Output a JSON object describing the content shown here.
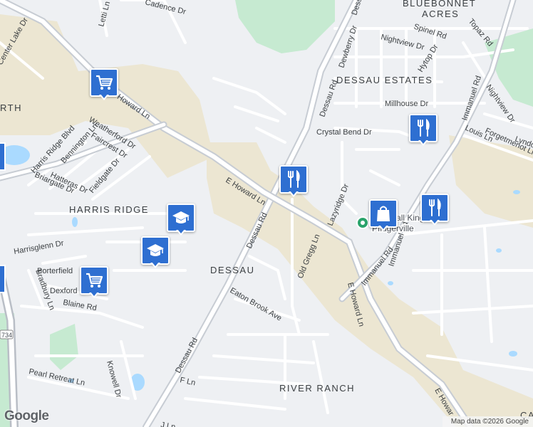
{
  "map": {
    "area_labels": {
      "bluebonnet_acres_1": "BLUEBONNET",
      "bluebonnet_acres_2": "ACRES",
      "dessau_estates": "DESSAU ESTATES",
      "harris_ridge": "HARRIS RIDGE",
      "dessau": "DESSAU",
      "river_ranch": "RIVER RANCH",
      "north_partial": "RTH",
      "ca_partial": "CA"
    },
    "road_labels": {
      "dessau_rd_top": "Dessau",
      "dessau_rd_1": "Dessau Rd",
      "dessau_rd_2": "Dessau Rd",
      "dessau_rd_3": "Dessau Rd",
      "e_howard_1": "E Howard Ln",
      "e_howard_2": "E Howard Ln",
      "e_howard_3": "E Howard Ln",
      "e_howard_4": "E Howar",
      "harris_ridge_blvd": "Harris Ridge Blvd",
      "immanuel_1": "Immanuel Rd",
      "immanuel_2": "Immanuel Rd",
      "immanuel_3": "Immanuel Rd",
      "spinel": "Spinel Rd",
      "topaz": "Topaz Rd",
      "nightview_1": "Nightview Dr",
      "nightview_2": "Nightview Dr",
      "hytop": "Hytop Dr",
      "dewberry": "Dewberry Dr",
      "millhouse": "Millhouse Dr",
      "crystal_bend": "Crystal Bend Dr",
      "louis": "Louis Ln",
      "forgetmenot": "Forgetmenot Ln",
      "lyndon": "Lyndo",
      "lazyridge": "Lazyridge Dr",
      "old_gregg": "Old Gregg Ln",
      "eaton_brook": "Eaton Brook Ave",
      "weatherford": "Weatherford Dr",
      "faircrest": "Faircrest Dr",
      "bennington": "Bennington Ln",
      "hatteras": "Hatteras Dr",
      "fieldgate": "Fieldgate Dr",
      "briargate": "Briargate Dr",
      "harrisglenn": "Harrisglenn Dr",
      "porterfield": "Porterfield",
      "dexford": "Dexford",
      "bradbury": "Bradbury Ln",
      "blaine": "Blaine Rd",
      "pearl_retreat": "Pearl Retreat Ln",
      "knowell": "Knowell Dr",
      "f_ln": "F Ln",
      "j_ln": "J Ln",
      "cadence": "Cadence Dr",
      "letti": "Letti Ln",
      "center_lake": "Center Lake Dr",
      "shield_734": "734"
    },
    "poi_labels": {
      "baseball_line1": "Baseball Kingdom",
      "baseball_line2": "Pflugerville"
    }
  },
  "pins": [
    {
      "type": "shopping-cart",
      "icon": "shopping-cart-icon"
    },
    {
      "type": "restaurant",
      "icon": "fork-knife-icon"
    },
    {
      "type": "restaurant",
      "icon": "fork-knife-icon"
    },
    {
      "type": "restaurant",
      "icon": "fork-knife-icon"
    },
    {
      "type": "shopping-bag",
      "icon": "shopping-bag-icon"
    },
    {
      "type": "school",
      "icon": "graduation-cap-icon"
    },
    {
      "type": "school",
      "icon": "graduation-cap-icon"
    },
    {
      "type": "shopping-cart",
      "icon": "shopping-cart-icon"
    }
  ],
  "footer": {
    "logo": "Google",
    "attribution": "Map data ©2026 Google"
  },
  "colors": {
    "background": "#eef0f3",
    "park_green": "#c6ead1",
    "commercial_tan": "#ece6d2",
    "water_blue": "#aadaff",
    "road_white": "#ffffff",
    "arterial_grey": "#c7ccd3",
    "pin_blue": "#2e6fd1"
  }
}
